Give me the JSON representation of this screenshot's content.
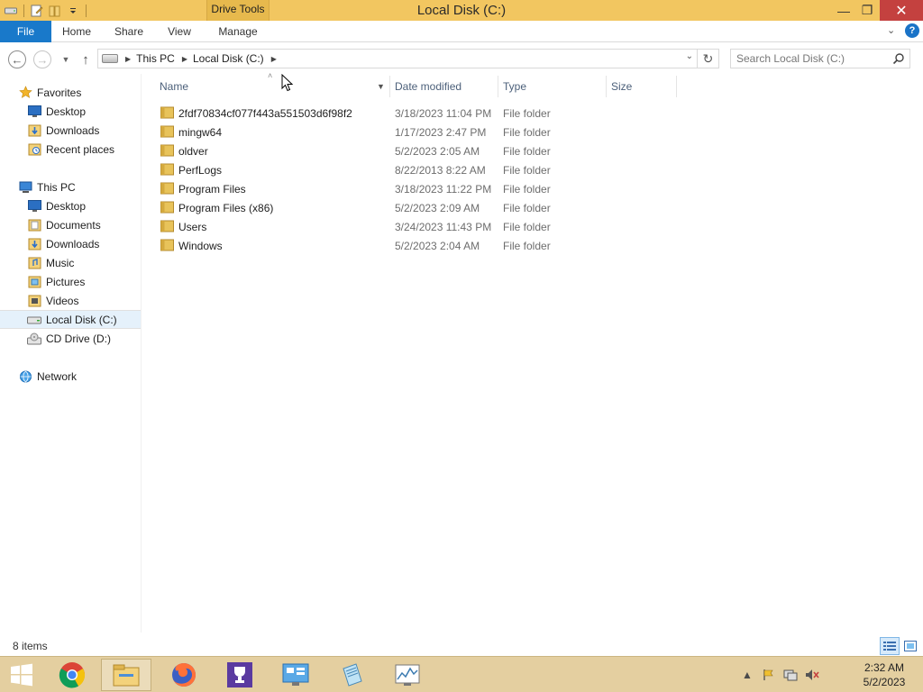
{
  "window": {
    "title": "Local Disk (C:)",
    "context_tab": "Drive Tools",
    "minimize": "—",
    "maximize": "❐",
    "close": "✕"
  },
  "ribbon": {
    "file": "File",
    "home": "Home",
    "share": "Share",
    "view": "View",
    "manage": "Manage"
  },
  "address": {
    "crumbs": [
      "This PC",
      "Local Disk (C:)"
    ],
    "search_placeholder": "Search Local Disk (C:)"
  },
  "navpane": {
    "favorites": {
      "label": "Favorites",
      "items": [
        "Desktop",
        "Downloads",
        "Recent places"
      ]
    },
    "this_pc": {
      "label": "This PC",
      "items": [
        "Desktop",
        "Documents",
        "Downloads",
        "Music",
        "Pictures",
        "Videos",
        "Local Disk (C:)",
        "CD Drive (D:)"
      ]
    },
    "network": {
      "label": "Network"
    },
    "selected": "Local Disk (C:)"
  },
  "columns": {
    "name": "Name",
    "date": "Date modified",
    "type": "Type",
    "size": "Size"
  },
  "files": [
    {
      "name": "2fdf70834cf077f443a551503d6f98f2",
      "date": "3/18/2023 11:04 PM",
      "type": "File folder"
    },
    {
      "name": "mingw64",
      "date": "1/17/2023 2:47 PM",
      "type": "File folder"
    },
    {
      "name": "oldver",
      "date": "5/2/2023 2:05 AM",
      "type": "File folder"
    },
    {
      "name": "PerfLogs",
      "date": "8/22/2013 8:22 AM",
      "type": "File folder"
    },
    {
      "name": "Program Files",
      "date": "3/18/2023 11:22 PM",
      "type": "File folder"
    },
    {
      "name": "Program Files (x86)",
      "date": "5/2/2023 2:09 AM",
      "type": "File folder"
    },
    {
      "name": "Users",
      "date": "3/24/2023 11:43 PM",
      "type": "File folder"
    },
    {
      "name": "Windows",
      "date": "5/2/2023 2:04 AM",
      "type": "File folder"
    }
  ],
  "status": {
    "item_count": "8 items"
  },
  "taskbar": {
    "apps": [
      "chrome-icon",
      "file-explorer-icon",
      "firefox-icon",
      "trophy-app-icon",
      "control-panel-icon",
      "notepad-icon",
      "performance-monitor-icon"
    ],
    "clock_time": "2:32 AM",
    "clock_date": "5/2/2023"
  },
  "colors": {
    "titlebar": "#f2c660",
    "file_tab": "#1979ca",
    "close_button": "#c4413f",
    "taskbar": "#e4cfa0",
    "folder": "#e8c35a"
  }
}
